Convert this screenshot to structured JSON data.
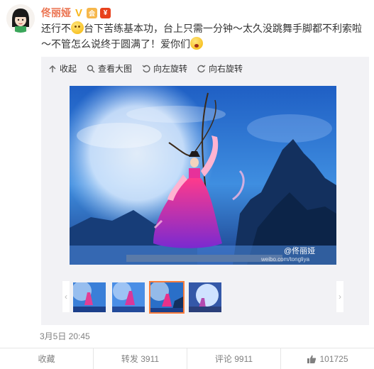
{
  "post": {
    "username": "佟丽娅",
    "badges": {
      "verified": "V",
      "vip": "会",
      "member": "¥"
    },
    "text_part1": "还行不",
    "text_part2": "台下苦练基本功，台上只需一分钟～太久没跳舞手脚都不利索啦～不管怎么说终于圆满了！爱你们",
    "emoji1": "smile-emoji",
    "emoji2": "surprise-emoji",
    "timestamp": "3月5日 20:45"
  },
  "toolbar": {
    "collapse": "收起",
    "view_large": "查看大图",
    "rotate_left": "向左旋转",
    "rotate_right": "向右旋转"
  },
  "image": {
    "watermark": "@佟丽娅",
    "watermark_url": "weibo.com/tongliya"
  },
  "thumbnails": {
    "count": 4,
    "active_index": 2
  },
  "actions": {
    "collect": "收藏",
    "repost": "转发 3911",
    "comment": "评论 9911",
    "like": "101725"
  },
  "colors": {
    "accent": "#eb7350",
    "thumb_active": "#fa7d3c"
  }
}
